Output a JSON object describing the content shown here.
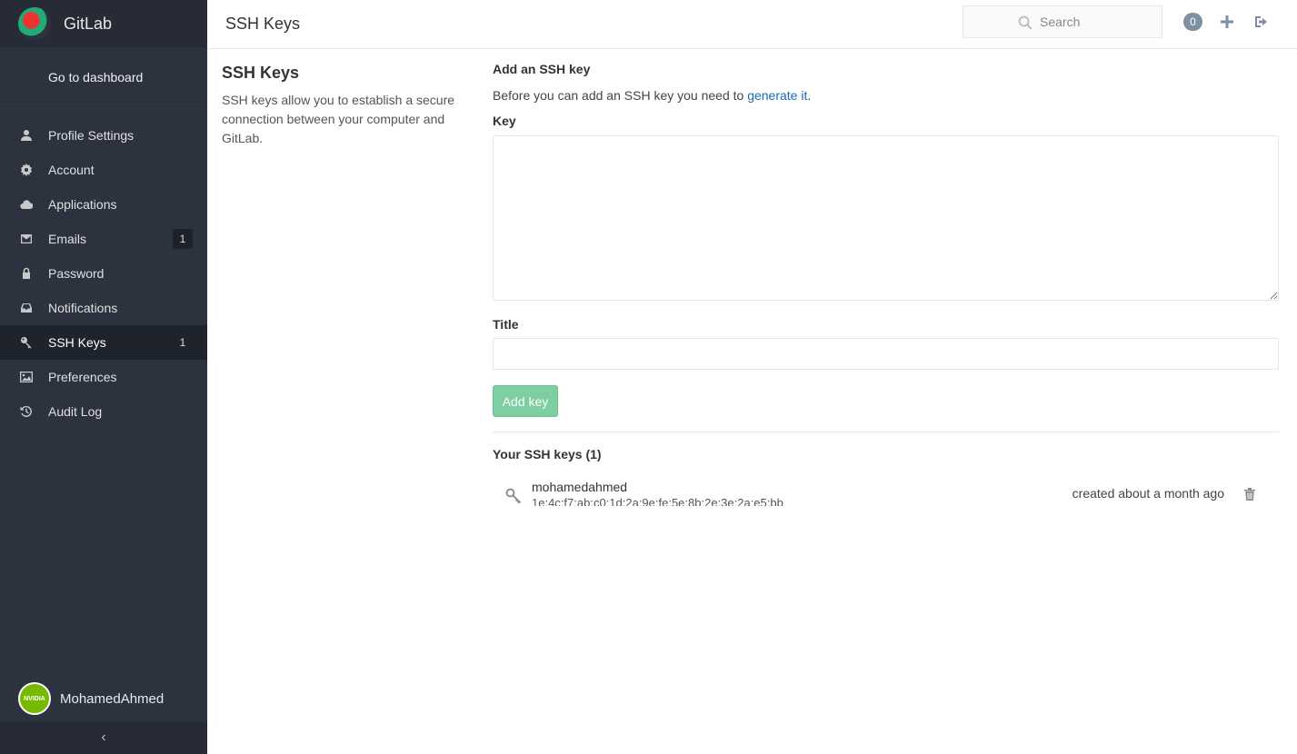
{
  "sidebar": {
    "brand": "GitLab",
    "dashboard_link": "Go to dashboard",
    "items": [
      {
        "label": "Profile Settings",
        "icon": "user-icon",
        "badge": ""
      },
      {
        "label": "Account",
        "icon": "gear-icon",
        "badge": ""
      },
      {
        "label": "Applications",
        "icon": "cloud-icon",
        "badge": ""
      },
      {
        "label": "Emails",
        "icon": "envelope-icon",
        "badge": "1"
      },
      {
        "label": "Password",
        "icon": "lock-icon",
        "badge": ""
      },
      {
        "label": "Notifications",
        "icon": "inbox-icon",
        "badge": ""
      },
      {
        "label": "SSH Keys",
        "icon": "key-icon",
        "badge": "1",
        "active": true
      },
      {
        "label": "Preferences",
        "icon": "image-icon",
        "badge": ""
      },
      {
        "label": "Audit Log",
        "icon": "history-icon",
        "badge": ""
      }
    ],
    "user_name": "MohamedAhmed",
    "avatar_text": "NVIDIA",
    "collapse_glyph": "‹"
  },
  "header": {
    "title": "SSH Keys",
    "search_placeholder": "Search",
    "todo_count": "0"
  },
  "description": {
    "title": "SSH Keys",
    "text": "SSH keys allow you to establish a secure connection between your computer and GitLab."
  },
  "form": {
    "heading": "Add an SSH key",
    "help_prefix": "Before you can add an SSH key you need to ",
    "help_link": "generate it",
    "help_suffix": ".",
    "key_label": "Key",
    "key_value": "",
    "title_label": "Title",
    "title_value": "",
    "submit_label": "Add key"
  },
  "keys": {
    "heading": "Your SSH keys (1)",
    "list": [
      {
        "name": "mohamedahmed",
        "fingerprint": "1e:4c:f7:ab:c0:1d:2a:9e:fe:5e:8b:2e:3e:2a:e5:bb",
        "created": "created about a month ago"
      }
    ]
  },
  "colors": {
    "sidebar_bg": "#2d323f",
    "accent_green": "#7dcfa1",
    "link_blue": "#1b69b6"
  }
}
